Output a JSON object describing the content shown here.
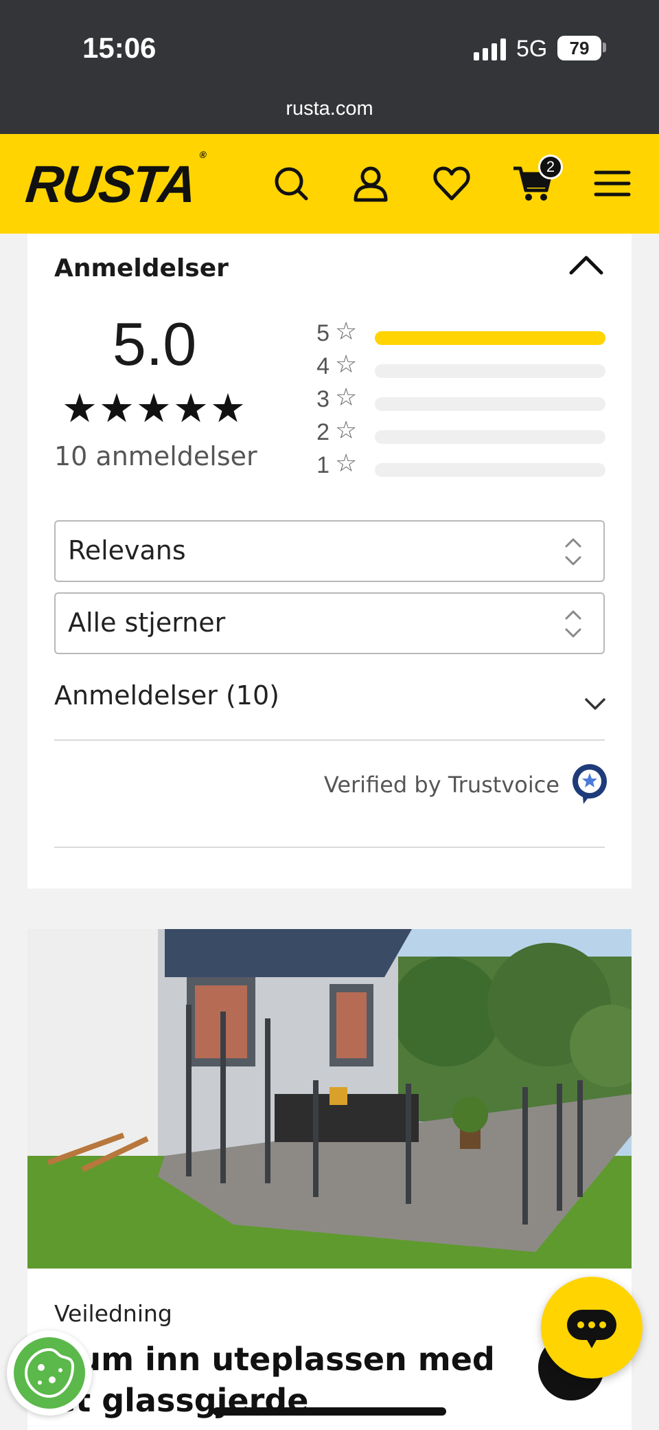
{
  "status_bar": {
    "time": "15:06",
    "network": "5G",
    "battery": "79"
  },
  "browser": {
    "url": "rusta.com"
  },
  "header": {
    "logo": "RUSTA",
    "logo_mark": "®",
    "cart_count": "2",
    "icons": [
      "search-icon",
      "account-icon",
      "heart-icon",
      "cart-icon",
      "menu-icon"
    ],
    "brand_color": "#ffd400"
  },
  "reviews": {
    "title": "Anmeldelser",
    "score": "5.0",
    "stars": "★★★★★",
    "count_label": "10 anmeldelser",
    "distribution": [
      {
        "label": "5",
        "star": "☆",
        "fraction": 1.0
      },
      {
        "label": "4",
        "star": "☆",
        "fraction": 0
      },
      {
        "label": "3",
        "star": "☆",
        "fraction": 0
      },
      {
        "label": "2",
        "star": "☆",
        "fraction": 0
      },
      {
        "label": "1",
        "star": "☆",
        "fraction": 0
      }
    ],
    "sort_select": "Relevans",
    "stars_select": "Alle stjerner",
    "list_toggle": "Anmeldelser (10)",
    "verified": "Verified by Trustvoice"
  },
  "article": {
    "category": "Veiledning",
    "title": "Rum inn uteplassen med et glassgjerde"
  }
}
